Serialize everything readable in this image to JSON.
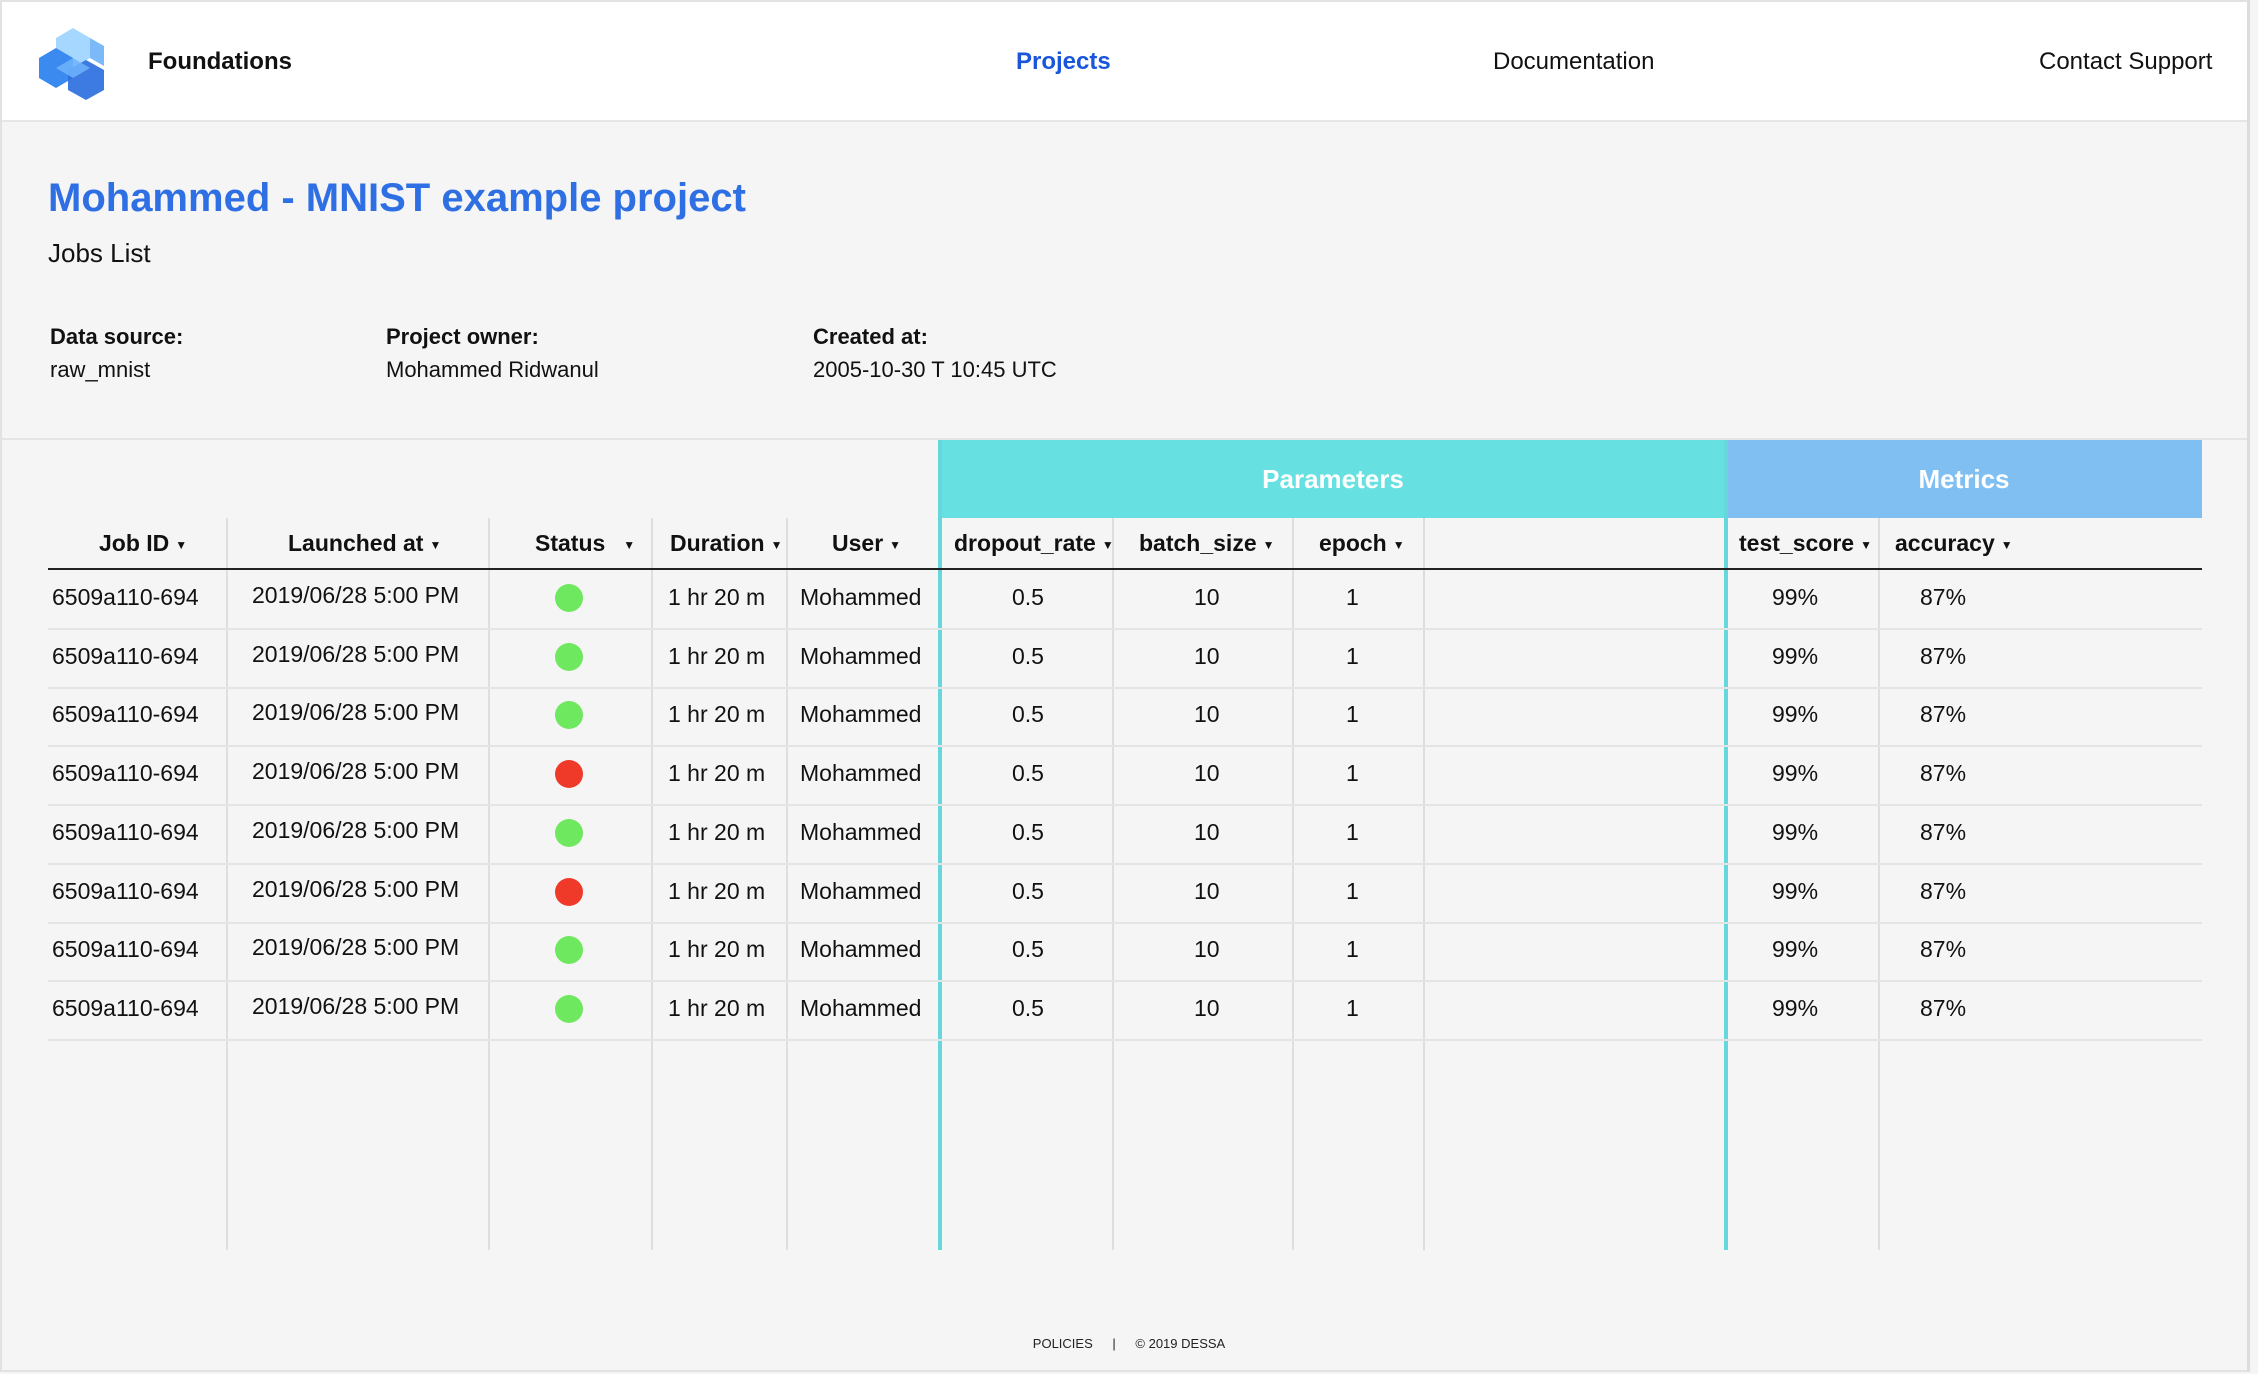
{
  "header": {
    "brand": "Foundations",
    "nav": [
      {
        "label": "Projects",
        "active": true
      },
      {
        "label": "Documentation",
        "active": false
      },
      {
        "label": "Contact Support",
        "active": false
      }
    ]
  },
  "project": {
    "title": "Mohammed - MNIST example project",
    "subtitle": "Jobs List",
    "data_source_label": "Data source:",
    "data_source": "raw_mnist",
    "owner_label": "Project owner:",
    "owner": "Mohammed Ridwanul",
    "created_label": "Created at:",
    "created": "2005-10-30 T 10:45 UTC"
  },
  "table": {
    "groups": {
      "parameters": "Parameters",
      "metrics": "Metrics"
    },
    "columns": [
      "Job ID",
      "Launched at",
      "Status",
      "Duration",
      "User",
      "dropout_rate",
      "batch_size",
      "epoch",
      "test_score",
      "accuracy"
    ],
    "status_colors": {
      "success": "#6ee85e",
      "failed": "#ef3a2a"
    },
    "rows": [
      {
        "job_id": "6509a110-694",
        "launched": "2019/06/28 5:00 PM",
        "status": "success",
        "duration": "1 hr 20 m",
        "user": "Mohammed",
        "dropout_rate": "0.5",
        "batch_size": "10",
        "epoch": "1",
        "test_score": "99%",
        "accuracy": "87%"
      },
      {
        "job_id": "6509a110-694",
        "launched": "2019/06/28 5:00 PM",
        "status": "success",
        "duration": "1 hr 20 m",
        "user": "Mohammed",
        "dropout_rate": "0.5",
        "batch_size": "10",
        "epoch": "1",
        "test_score": "99%",
        "accuracy": "87%"
      },
      {
        "job_id": "6509a110-694",
        "launched": "2019/06/28 5:00 PM",
        "status": "success",
        "duration": "1 hr 20 m",
        "user": "Mohammed",
        "dropout_rate": "0.5",
        "batch_size": "10",
        "epoch": "1",
        "test_score": "99%",
        "accuracy": "87%"
      },
      {
        "job_id": "6509a110-694",
        "launched": "2019/06/28 5:00 PM",
        "status": "failed",
        "duration": "1 hr 20 m",
        "user": "Mohammed",
        "dropout_rate": "0.5",
        "batch_size": "10",
        "epoch": "1",
        "test_score": "99%",
        "accuracy": "87%"
      },
      {
        "job_id": "6509a110-694",
        "launched": "2019/06/28 5:00 PM",
        "status": "success",
        "duration": "1 hr 20 m",
        "user": "Mohammed",
        "dropout_rate": "0.5",
        "batch_size": "10",
        "epoch": "1",
        "test_score": "99%",
        "accuracy": "87%"
      },
      {
        "job_id": "6509a110-694",
        "launched": "2019/06/28 5:00 PM",
        "status": "failed",
        "duration": "1 hr 20 m",
        "user": "Mohammed",
        "dropout_rate": "0.5",
        "batch_size": "10",
        "epoch": "1",
        "test_score": "99%",
        "accuracy": "87%"
      },
      {
        "job_id": "6509a110-694",
        "launched": "2019/06/28 5:00 PM",
        "status": "success",
        "duration": "1 hr 20 m",
        "user": "Mohammed",
        "dropout_rate": "0.5",
        "batch_size": "10",
        "epoch": "1",
        "test_score": "99%",
        "accuracy": "87%"
      },
      {
        "job_id": "6509a110-694",
        "launched": "2019/06/28 5:00 PM",
        "status": "success",
        "duration": "1 hr 20 m",
        "user": "Mohammed",
        "dropout_rate": "0.5",
        "batch_size": "10",
        "epoch": "1",
        "test_score": "99%",
        "accuracy": "87%"
      }
    ]
  },
  "footer": {
    "policies": "POLICIES",
    "separator": "|",
    "copyright": "© 2019 DESSA"
  }
}
